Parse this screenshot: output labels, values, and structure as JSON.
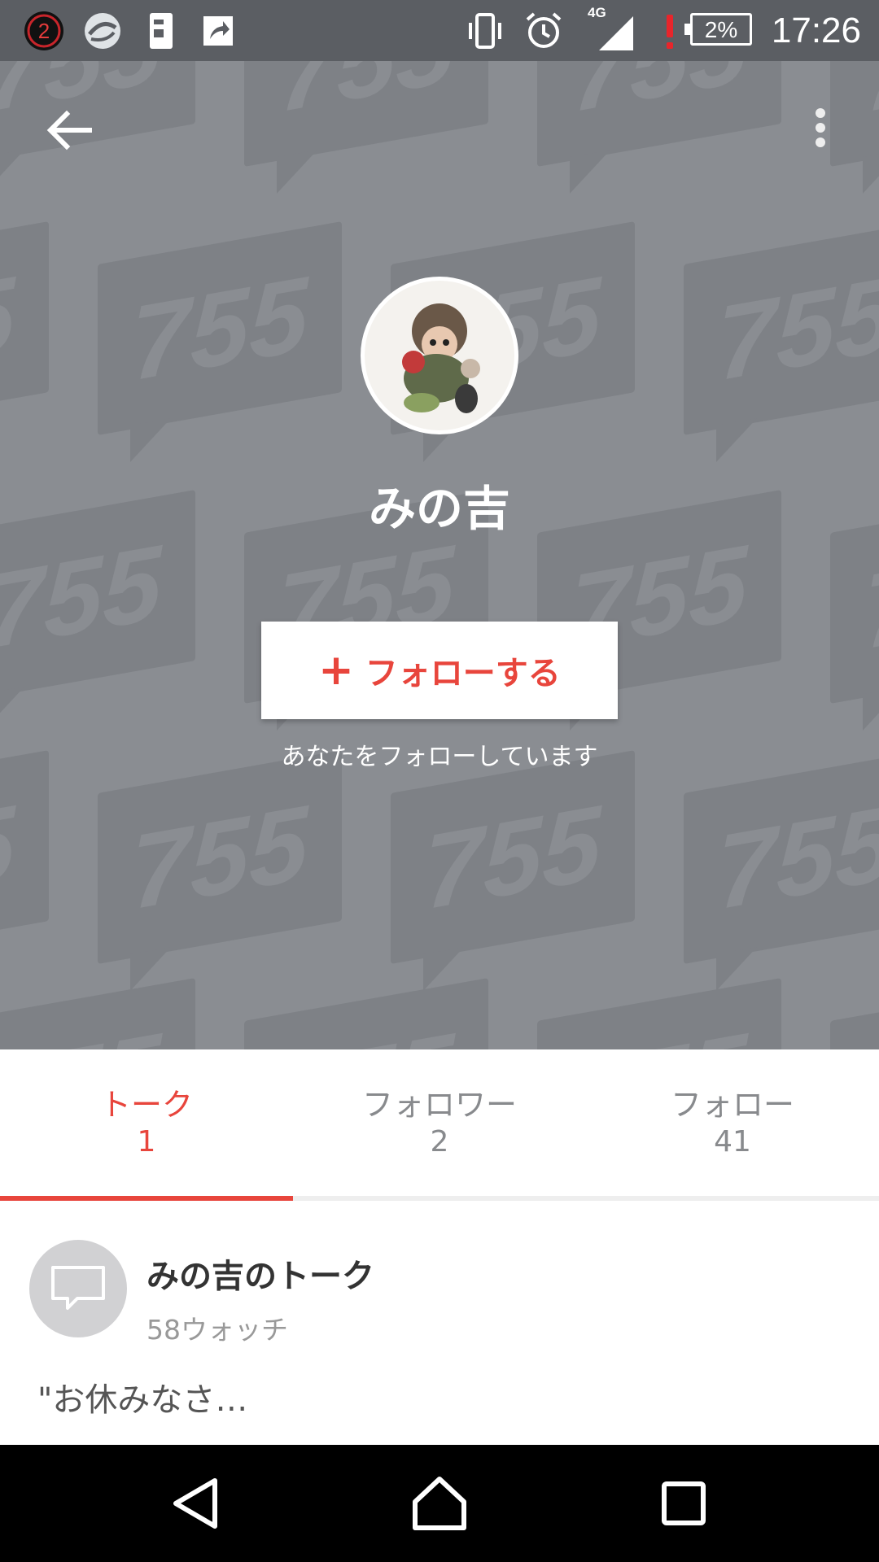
{
  "status_bar": {
    "notification_count": "2",
    "battery_percent": "2%",
    "network_type": "4G",
    "time": "17:26",
    "icons": [
      "notification-badge-icon",
      "spin-app-icon",
      "phone-app-icon",
      "share-app-icon",
      "vibrate-icon",
      "alarm-icon",
      "signal-icon",
      "alert-icon",
      "battery-icon"
    ]
  },
  "header": {
    "back_icon": "arrow-left-icon",
    "more_icon": "more-vertical-icon",
    "watermark_text": "755",
    "profile_name": "みの吉",
    "follow_button_plus": "+",
    "follow_button_label": "フォローする",
    "follow_status": "あなたをフォローしています"
  },
  "tabs": [
    {
      "label": "トーク",
      "count": "1",
      "active": true
    },
    {
      "label": "フォロワー",
      "count": "2",
      "active": false
    },
    {
      "label": "フォロー",
      "count": "41",
      "active": false
    }
  ],
  "talk": {
    "title": "みの吉のトーク",
    "watch_count": "58ウォッチ",
    "preview": "\"お休みなさ…"
  },
  "colors": {
    "accent": "#e8453c",
    "header_bg": "#8a8d92",
    "statusbar_bg": "#5b5e63",
    "navbar_bg": "#000000"
  },
  "navbar": {
    "icons": [
      "back-triangle-icon",
      "home-icon",
      "recents-icon"
    ]
  }
}
